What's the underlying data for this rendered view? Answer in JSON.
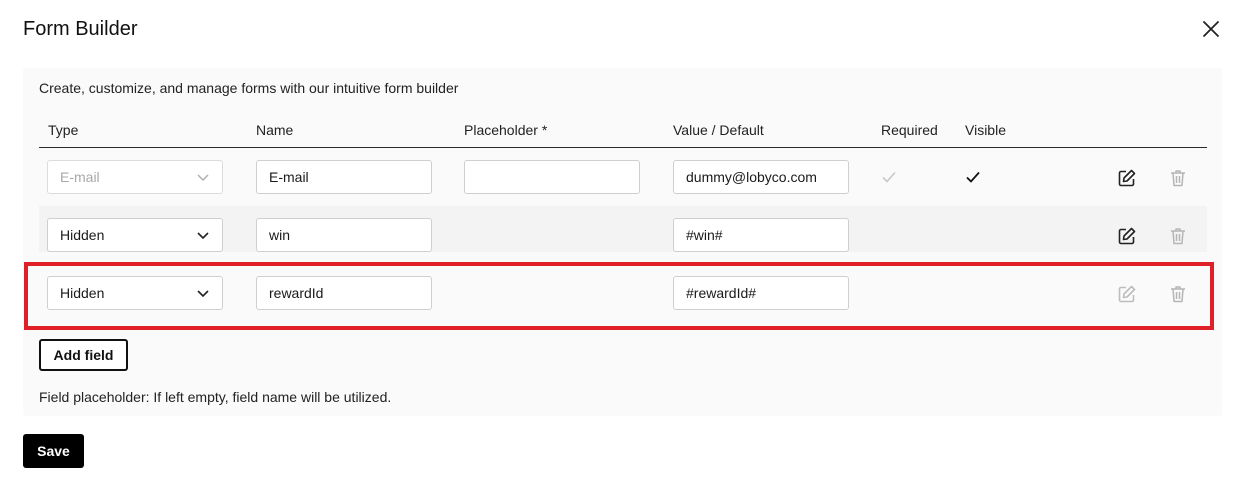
{
  "dialog": {
    "title": "Form Builder",
    "description": "Create, customize, and manage forms with our intuitive form builder",
    "footnote": "Field placeholder: If left empty, field name will be utilized."
  },
  "table": {
    "headers": {
      "type": "Type",
      "name": "Name",
      "placeholder": "Placeholder *",
      "value": "Value / Default",
      "required": "Required",
      "visible": "Visible"
    },
    "rows": [
      {
        "type": "E-mail",
        "type_disabled": true,
        "name": "E-mail",
        "placeholder": "",
        "value": "dummy@lobyco.com",
        "required": true,
        "required_disabled": true,
        "visible": true,
        "edit_enabled": true
      },
      {
        "type": "Hidden",
        "type_disabled": false,
        "name": "win",
        "value": "#win#",
        "edit_enabled": true
      },
      {
        "type": "Hidden",
        "type_disabled": false,
        "name": "rewardId",
        "value": "#rewardId#",
        "edit_enabled": false,
        "highlighted": true
      }
    ]
  },
  "buttons": {
    "add_field": "Add field",
    "save": "Save"
  },
  "colors": {
    "highlight": "#e02027",
    "primary": "#000000",
    "panel": "#fafafa"
  }
}
